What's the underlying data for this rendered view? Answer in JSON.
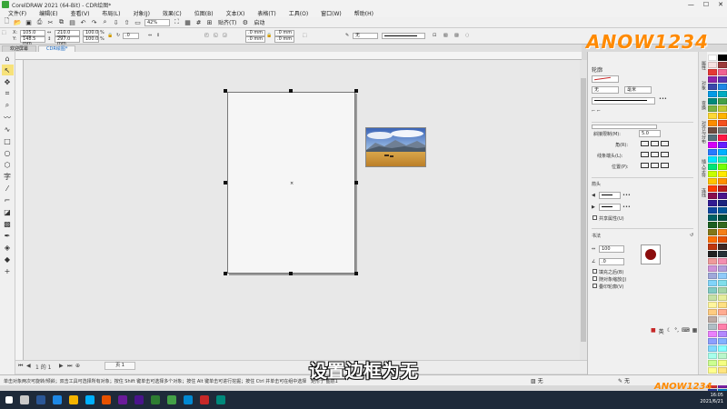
{
  "window": {
    "title": "CorelDRAW 2021 (64-Bit) - CDR绘图*"
  },
  "menu": [
    "文件(F)",
    "编辑(E)",
    "查看(V)",
    "布局(L)",
    "对象(J)",
    "效果(C)",
    "位图(B)",
    "文本(X)",
    "表格(T)",
    "工具(O)",
    "窗口(W)",
    "帮助(H)"
  ],
  "toolbar": {
    "zoom": "42%",
    "snap": "贴齐(T)",
    "launch": "启动"
  },
  "propbar": {
    "x": "105.0 mm",
    "y": "148.5 mm",
    "w": "210.0 mm",
    "h": "297.0 mm",
    "sx": "100.0",
    "sy": "100.0",
    "pct": "%",
    "angle": ".0",
    "corner1": ".0 mm",
    "corner2": ".0 mm",
    "corner3": ".0 mm",
    "corner4": ".0 mm",
    "outline": "无"
  },
  "tabs": [
    "欢迎屏幕",
    "CDR绘图*"
  ],
  "docker": {
    "title": "轮廓",
    "width_val": "无",
    "unit": "毫米",
    "miter_label": "斜接限制(M):",
    "miter_val": "5.0",
    "corner_label": "角(R):",
    "caps_label": "线条端头(L):",
    "position_label": "位置(P):",
    "arrows_label": "箭头",
    "share_attrs": "共享属性(U)",
    "calligraphy_label": "书法",
    "stretch_val": "100",
    "angle_val": ".0",
    "fill_behind": "填充之后(B)",
    "scale_with": "随对象缩放(J)",
    "overprint": "叠印轮廓(V)"
  },
  "sidetabs": [
    "属性",
    "对象",
    "变换",
    "对齐与分布",
    "插入字符",
    "连线"
  ],
  "canvas": {
    "page_nav": "1 的 1",
    "page_tab": "页 1"
  },
  "status": {
    "hint": "单击对象两次可旋转/倾斜；双击工具可选择所有对象；按住 Shift 键单击可选择多个对象；按住 Alt 键单击可进行挖掘；按住 Ctrl 并单击可在组中选择",
    "selection": "矩形于 图层1",
    "fill": "无",
    "stroke": "无"
  },
  "subtitle": "设置边框为无",
  "watermark": "ANOW1234",
  "clock": {
    "time": "16:05",
    "date": "2021/6/21"
  },
  "colors": {
    "accent": "#1565c0",
    "watermark": "#ff8a00",
    "taskbar": "#1e2a3a",
    "palette": [
      "#ffffff",
      "#000000",
      "#f6e0e0",
      "#9b3a3a",
      "#e53935",
      "#f06292",
      "#8e24aa",
      "#5e35b1",
      "#3949ab",
      "#1e88e5",
      "#039be5",
      "#00acc1",
      "#00897b",
      "#43a047",
      "#7cb342",
      "#c0ca33",
      "#fdd835",
      "#ffb300",
      "#fb8c00",
      "#f4511e",
      "#6d4c41",
      "#757575",
      "#546e7a",
      "#ff1744",
      "#d500f9",
      "#651fff",
      "#2979ff",
      "#00b0ff",
      "#00e5ff",
      "#1de9b6",
      "#00e676",
      "#76ff03",
      "#c6ff00",
      "#ffea00",
      "#ffc400",
      "#ff9100",
      "#ff3d00",
      "#b71c1c",
      "#880e4f",
      "#4a148c",
      "#311b92",
      "#1a237e",
      "#0d47a1",
      "#01579b",
      "#006064",
      "#004d40",
      "#1b5e20",
      "#33691e",
      "#827717",
      "#f57f17",
      "#ff6f00",
      "#e65100",
      "#bf360c",
      "#3e2723",
      "#212121",
      "#263238",
      "#ef9a9a",
      "#f48fb1",
      "#ce93d8",
      "#b39ddb",
      "#9fa8da",
      "#90caf9",
      "#81d4fa",
      "#80deea",
      "#80cbc4",
      "#a5d6a7",
      "#c5e1a5",
      "#e6ee9c",
      "#fff59d",
      "#ffe082",
      "#ffcc80",
      "#ffab91",
      "#bcaaa4",
      "#eeeeee",
      "#b0bec5",
      "#ff80ab",
      "#ea80fc",
      "#b388ff",
      "#8c9eff",
      "#82b1ff",
      "#80d8ff",
      "#84ffff",
      "#a7ffeb",
      "#b9f6ca",
      "#ccff90",
      "#f4ff81",
      "#ffff8d",
      "#ffe57f",
      "#ffd180",
      "#ff9e80",
      "#d32f2f",
      "#7b1fa2",
      "#303f9f",
      "#0288d1",
      "#388e3c",
      "#fbc02d"
    ]
  }
}
